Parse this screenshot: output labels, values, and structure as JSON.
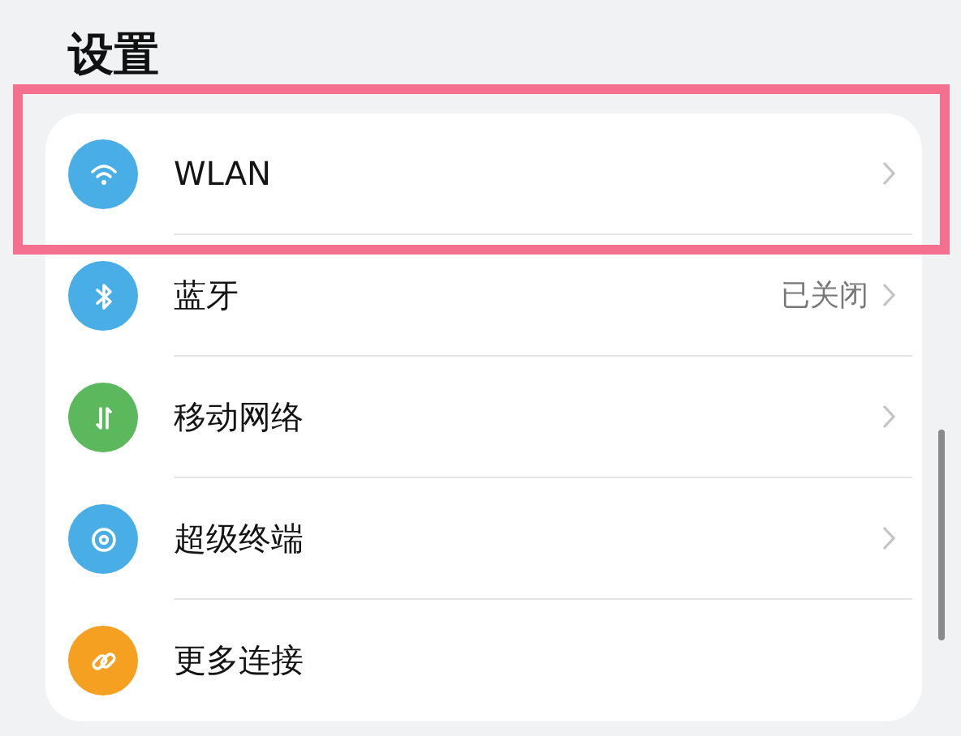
{
  "title": "设置",
  "items": [
    {
      "label": "WLAN",
      "kind": "wifi",
      "color": "#4aaee6",
      "value": null,
      "chevron": true,
      "highlighted": true
    },
    {
      "label": "蓝牙",
      "kind": "bluetooth",
      "color": "#4aaee6",
      "value": "已关闭",
      "chevron": true,
      "highlighted": false
    },
    {
      "label": "移动网络",
      "kind": "data",
      "color": "#5cb85c",
      "value": null,
      "chevron": true,
      "highlighted": false
    },
    {
      "label": "超级终端",
      "kind": "orbit",
      "color": "#4aaee6",
      "value": null,
      "chevron": true,
      "highlighted": false
    },
    {
      "label": "更多连接",
      "kind": "link",
      "color": "#f5a020",
      "value": null,
      "chevron": false,
      "highlighted": false
    }
  ]
}
